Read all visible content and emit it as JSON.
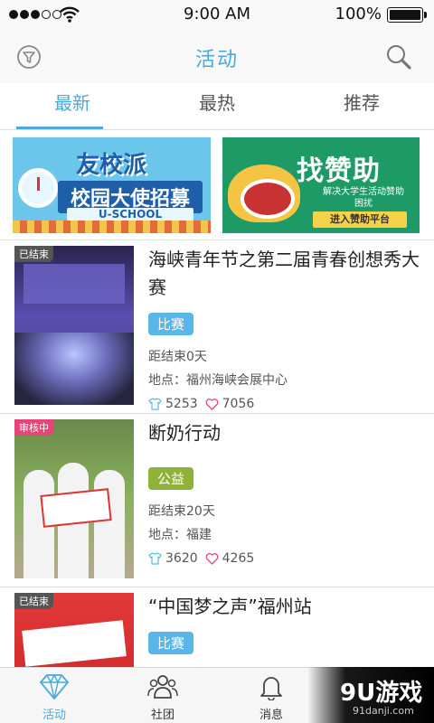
{
  "status_bar": {
    "time": "9:00 AM",
    "battery": "100%",
    "signal_dots": 5,
    "signal_filled": 3
  },
  "nav": {
    "title": "活动",
    "filter_icon": "filter-icon",
    "search_icon": "search-icon"
  },
  "tabs": [
    {
      "label": "最新",
      "active": true
    },
    {
      "label": "最热",
      "active": false
    },
    {
      "label": "推荐",
      "active": false
    }
  ],
  "banners": [
    {
      "brand": "友校派",
      "title": "校园大使招募",
      "subtitle": "U-SCHOOL"
    },
    {
      "title": "找赞助",
      "subtitle": "解决大学生活动赞助困扰",
      "button": "进入赞助平台"
    }
  ],
  "activities": [
    {
      "badge": "已结束",
      "title": "海峡青年节之第二届青春创想秀大赛",
      "tag": "比赛",
      "countdown": "距结束0天",
      "location": "地点：福州海峡会展中心",
      "views": "5253",
      "likes": "7056"
    },
    {
      "badge": "审核中",
      "title": "断奶行动",
      "tag": "公益",
      "countdown": "距结束20天",
      "location": "地点：福建",
      "views": "3620",
      "likes": "4265"
    },
    {
      "badge": "已结束",
      "title": "“中国梦之声”福州站",
      "tag": "比赛"
    }
  ],
  "bottom_tabs": [
    {
      "label": "活动",
      "icon": "diamond-icon",
      "active": true
    },
    {
      "label": "社团",
      "icon": "group-icon",
      "active": false
    },
    {
      "label": "消息",
      "icon": "bell-icon",
      "active": false
    }
  ],
  "watermark": {
    "main": "9U游戏",
    "sub": "91danji.com"
  },
  "colors": {
    "accent": "#4aa8dc",
    "tag_competition": "#59b6e8",
    "tag_charity": "#8fb33a",
    "badge_reviewing": "#e9447a"
  }
}
